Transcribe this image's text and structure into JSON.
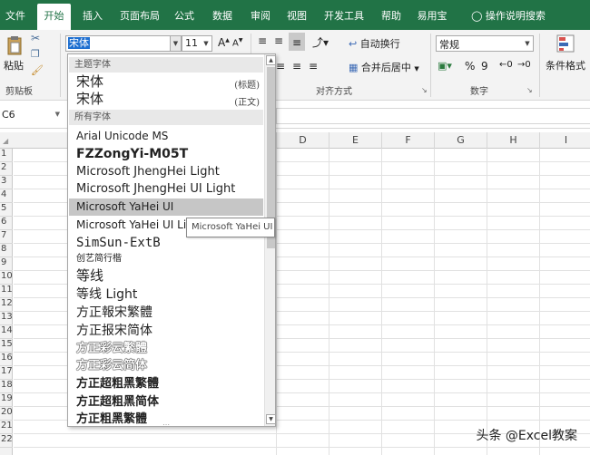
{
  "ribbon_tabs": [
    "文件",
    "开始",
    "插入",
    "页面布局",
    "公式",
    "数据",
    "审阅",
    "视图",
    "开发工具",
    "帮助",
    "易用宝"
  ],
  "tell_me": "操作说明搜索",
  "clipboard": {
    "paste": "粘贴",
    "group": "剪贴板"
  },
  "font_group": {
    "font_name": "宋体",
    "font_size": "11",
    "grow": "A",
    "shrink": "A"
  },
  "alignment": {
    "wrap_text": "自动换行",
    "merge_center": "合并后居中",
    "group": "对齐方式"
  },
  "number": {
    "format": "常规",
    "percent": "%",
    "comma": "9",
    "group": "数字"
  },
  "styles": {
    "conditional_format": "条件格式"
  },
  "formula_bar": {
    "name_box": "C6"
  },
  "grid": {
    "columns": [
      "D",
      "E",
      "F",
      "G",
      "H",
      "I"
    ],
    "rows": [
      "1",
      "2",
      "3",
      "4",
      "5",
      "6",
      "7",
      "8",
      "9",
      "10",
      "11",
      "12",
      "13",
      "14",
      "15",
      "16",
      "17",
      "18",
      "19",
      "20",
      "21",
      "22"
    ]
  },
  "font_dropdown": {
    "theme_header": "主题字体",
    "theme_fonts": [
      {
        "name": "宋体",
        "tag": "(标题)"
      },
      {
        "name": "宋体",
        "tag": "(正文)"
      }
    ],
    "all_header": "所有字体",
    "fonts": [
      "Arial Unicode MS",
      "FZZongYi-M05T",
      "Microsoft JhengHei Light",
      "Microsoft JhengHei UI Light",
      "Microsoft YaHei UI",
      "Microsoft YaHei UI Light",
      "SimSun-ExtB",
      "创艺简行楷",
      "等线",
      "等线 Light",
      "方正報宋繁體",
      "方正报宋简体",
      "方正彩云繁體",
      "方正彩云简体",
      "方正超粗黑繁體",
      "方正超粗黑简体",
      "方正粗黑繁體"
    ],
    "highlighted": "Microsoft YaHei UI"
  },
  "tooltip": "Microsoft YaHei UI",
  "watermark": "头条 @Excel教案",
  "colors": {
    "accent": "#217346"
  }
}
